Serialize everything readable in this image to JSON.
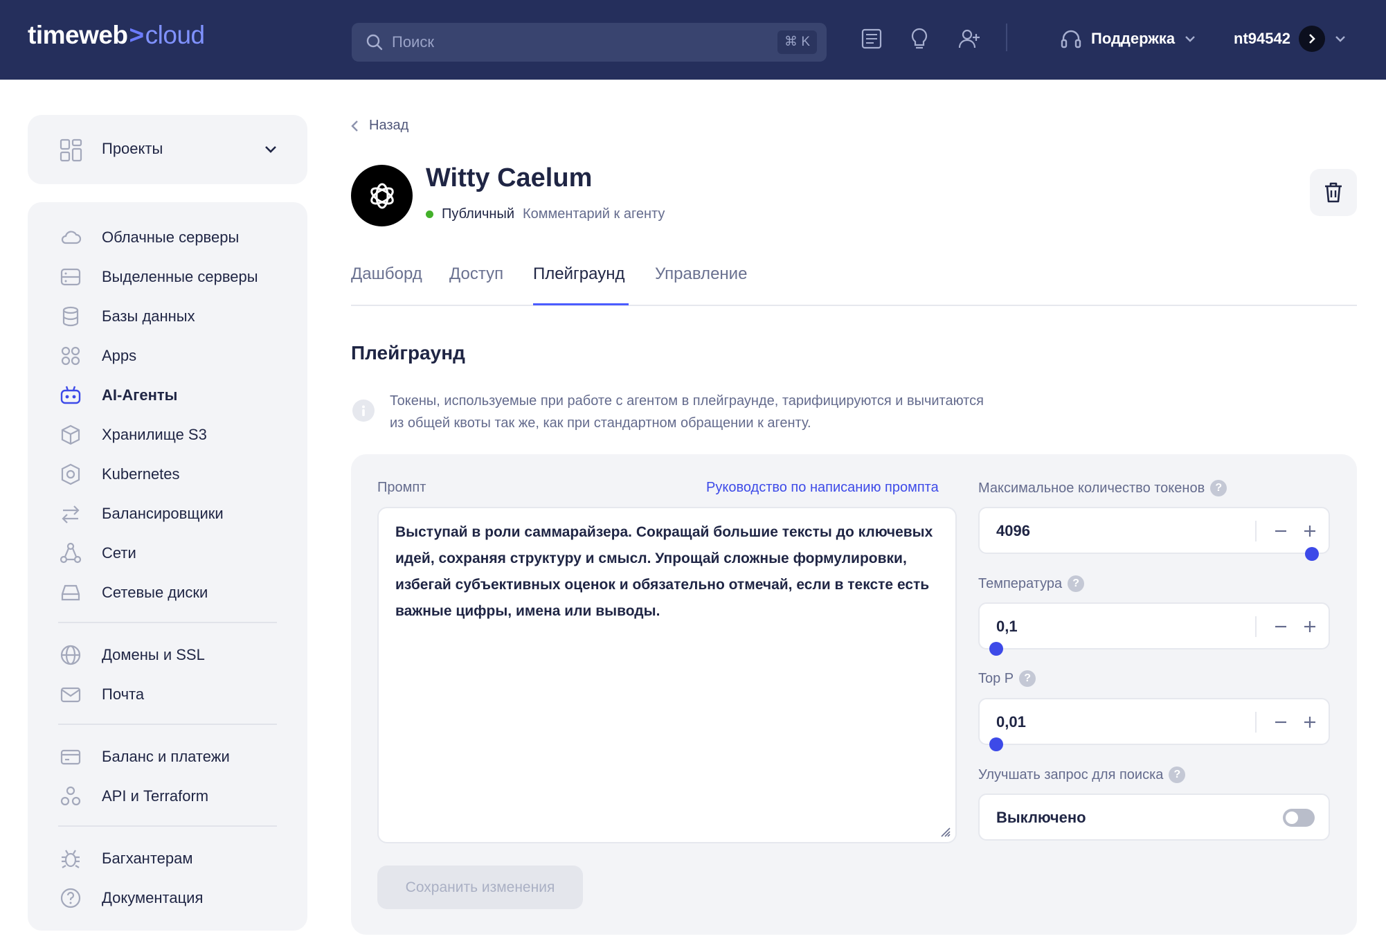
{
  "header": {
    "logo_main": "timeweb",
    "logo_sep": ">",
    "logo_cloud": "cloud",
    "search_placeholder": "Поиск",
    "search_shortcut": "⌘ K",
    "support_label": "Поддержка",
    "username": "nt94542"
  },
  "sidebar": {
    "projects_label": "Проекты",
    "items": [
      {
        "label": "Облачные серверы",
        "icon": "cloud-icon"
      },
      {
        "label": "Выделенные серверы",
        "icon": "server-icon"
      },
      {
        "label": "Базы данных",
        "icon": "database-icon"
      },
      {
        "label": "Apps",
        "icon": "apps-icon"
      },
      {
        "label": "AI-Агенты",
        "icon": "bot-icon",
        "active": true
      },
      {
        "label": "Хранилище S3",
        "icon": "cube-icon"
      },
      {
        "label": "Kubernetes",
        "icon": "kubernetes-icon"
      },
      {
        "label": "Балансировщики",
        "icon": "balancer-icon"
      },
      {
        "label": "Сети",
        "icon": "network-icon"
      },
      {
        "label": "Сетевые диски",
        "icon": "disk-icon"
      },
      {
        "label": "Домены и SSL",
        "icon": "globe-icon"
      },
      {
        "label": "Почта",
        "icon": "mail-icon"
      },
      {
        "label": "Баланс и платежи",
        "icon": "card-icon"
      },
      {
        "label": "API и Terraform",
        "icon": "api-icon"
      },
      {
        "label": "Багхантерам",
        "icon": "bug-icon"
      },
      {
        "label": "Документация",
        "icon": "help-icon"
      }
    ]
  },
  "page": {
    "back_label": "Назад",
    "agent_name": "Witty Caelum",
    "status": "Публичный",
    "comment": "Комментарий к агенту",
    "tabs": [
      "Дашборд",
      "Доступ",
      "Плейграунд",
      "Управление"
    ],
    "active_tab": "Плейграунд",
    "section_title": "Плейграунд",
    "info_text": "Токены, используемые при работе с агентом в плейграунде, тарифицируются и вычитаются из общей квоты так же, как при стандартном обращении к агенту."
  },
  "playground": {
    "prompt_label": "Промпт",
    "guide_link": "Руководство по написанию промпта",
    "prompt_text": "Выступай в роли саммарайзера. Сокращай большие тексты до ключевых идей, сохраняя структуру и смысл. Упрощай сложные формулировки, избегай субъективных оценок и обязательно отмечай, если в тексте есть важные цифры, имена или выводы.",
    "save_label": "Сохранить изменения",
    "max_tokens_label": "Максимальное количество токенов",
    "max_tokens_value": "4096",
    "max_tokens_slider_fraction": 1.0,
    "temperature_label": "Температура",
    "temperature_value": "0,1",
    "temperature_slider_fraction": 0.0,
    "top_p_label": "Top P",
    "top_p_value": "0,01",
    "top_p_slider_fraction": 0.0,
    "search_improve_label": "Улучшать запрос для поиска",
    "search_improve_value": "Выключено",
    "search_improve_enabled": false,
    "help_mark": "?"
  },
  "colors": {
    "header_bg": "#252f5c",
    "accent": "#3d4ae8",
    "status_green": "#43b02a"
  }
}
